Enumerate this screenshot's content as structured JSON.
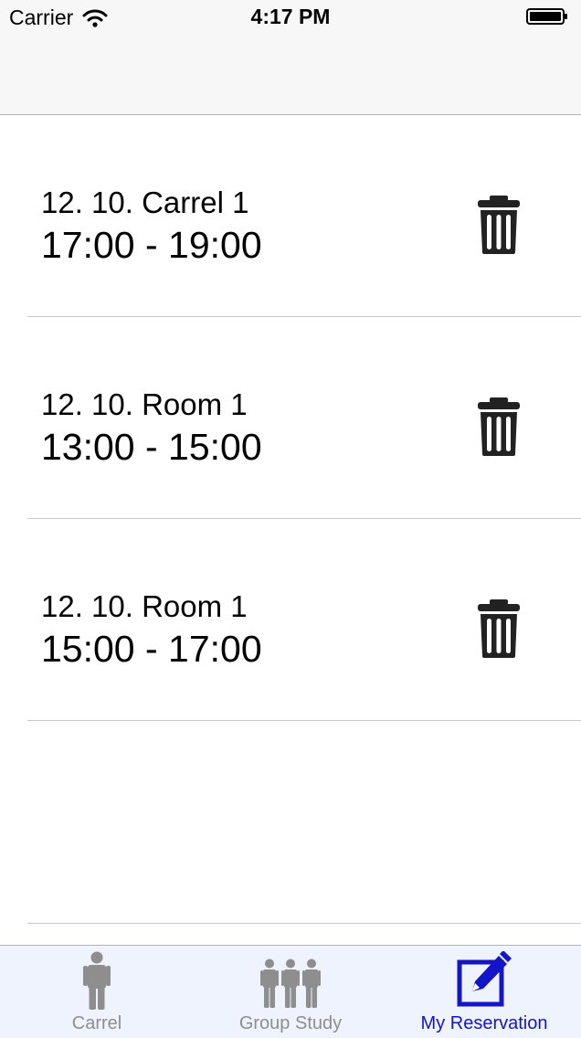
{
  "status_bar": {
    "carrier": "Carrier",
    "time": "4:17 PM"
  },
  "reservations": [
    {
      "title": "12. 10. Carrel 1",
      "time": "17:00 - 19:00"
    },
    {
      "title": "12. 10. Room 1",
      "time": "13:00 - 15:00"
    },
    {
      "title": "12. 10. Room 1",
      "time": "15:00 - 17:00"
    }
  ],
  "tabs": [
    {
      "label": "Carrel",
      "icon": "person-icon",
      "active": false
    },
    {
      "label": "Group Study",
      "icon": "group-icon",
      "active": false
    },
    {
      "label": "My Reservation",
      "icon": "edit-icon",
      "active": true
    }
  ],
  "colors": {
    "active_tab": "#1414c8",
    "inactive_tab": "#8e8e8e",
    "tabbar_bg": "#eef3fd",
    "trash_icon": "#222222"
  }
}
